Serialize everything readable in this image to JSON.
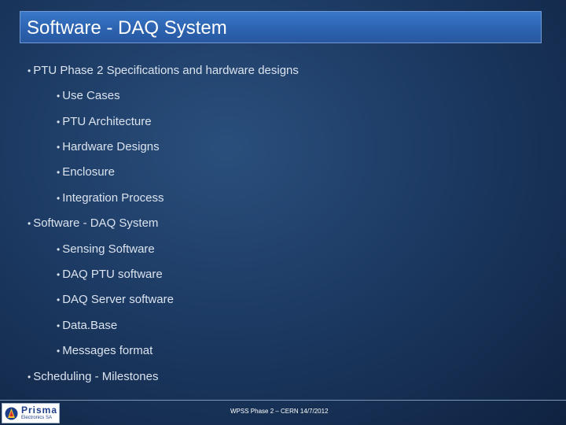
{
  "slide": {
    "title": "Software - DAQ System",
    "bullets": [
      {
        "text": "PTU Phase 2 Specifications and hardware designs",
        "level": 1
      },
      {
        "text": "Use Cases",
        "level": 2
      },
      {
        "text": "PTU Architecture",
        "level": 2
      },
      {
        "text": "Hardware Designs",
        "level": 2
      },
      {
        "text": "Enclosure",
        "level": 2
      },
      {
        "text": "Integration Process",
        "level": 2
      },
      {
        "text": "Software - DAQ System",
        "level": 1
      },
      {
        "text": "Sensing Software",
        "level": 2
      },
      {
        "text": "DAQ PTU software",
        "level": 2
      },
      {
        "text": "DAQ Server software",
        "level": 2
      },
      {
        "text": "Data.Base",
        "level": 2
      },
      {
        "text": "Messages format",
        "level": 2
      },
      {
        "text": "Scheduling - Milestones",
        "level": 1
      }
    ],
    "bullet_glyph": "•"
  },
  "footer": {
    "text": "WPSS Phase 2 – CERN 14/7/2012",
    "logo": {
      "name": "Prisma",
      "subtitle": "Electronics SA"
    }
  },
  "colors": {
    "title_bar": "#2c63b0",
    "background": "#1c3a63",
    "text": "#dbe3ee"
  }
}
